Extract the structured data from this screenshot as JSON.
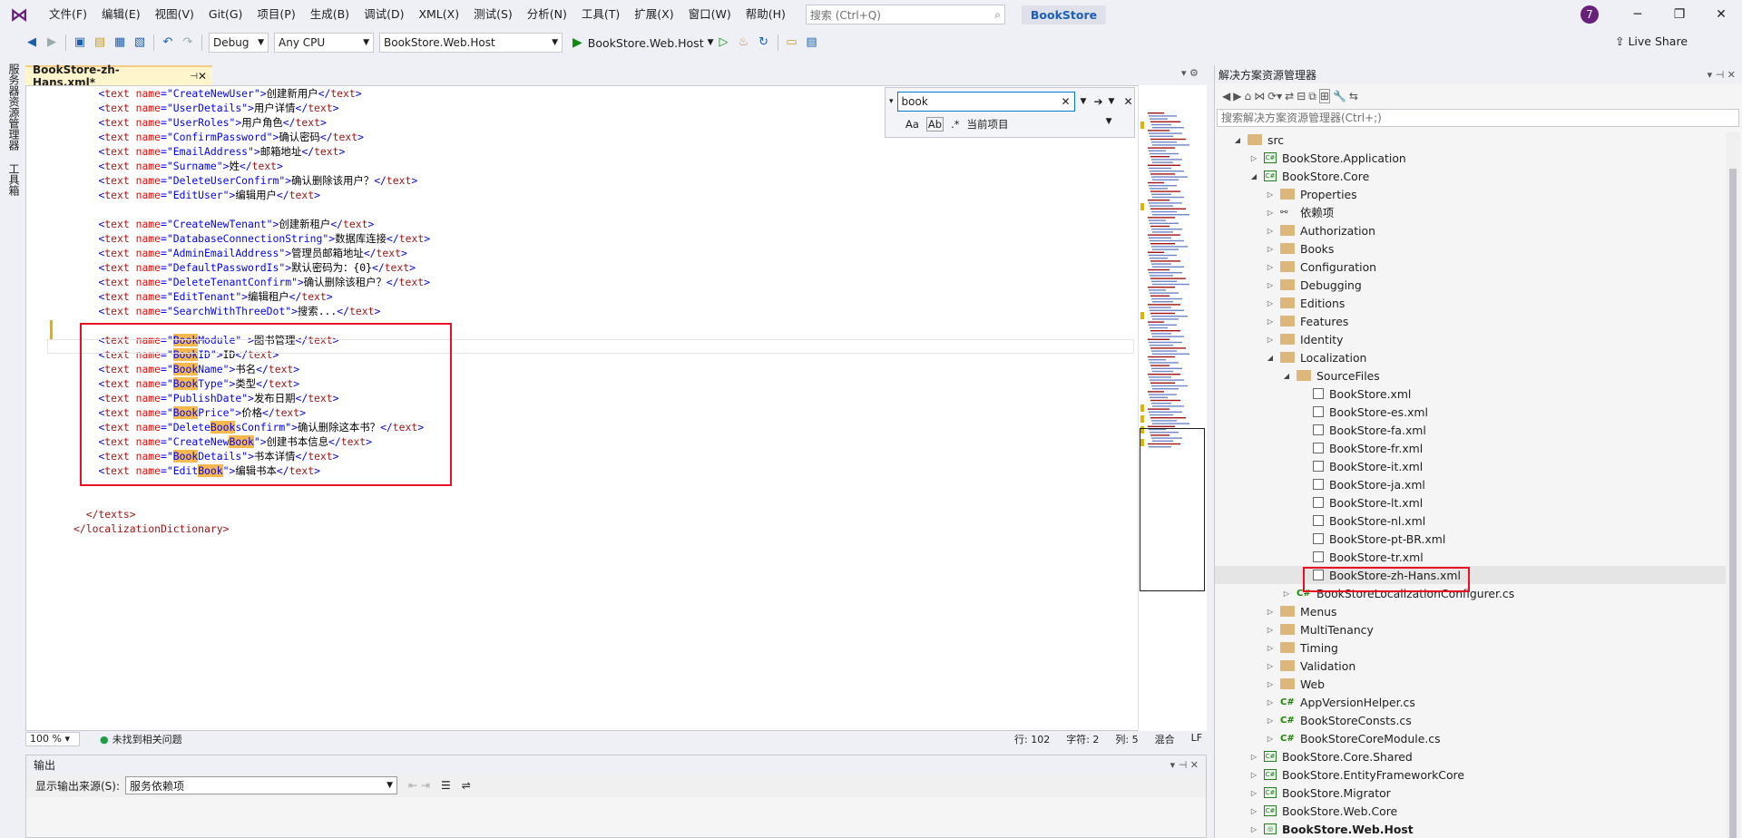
{
  "menu": [
    "文件(F)",
    "编辑(E)",
    "视图(V)",
    "Git(G)",
    "项目(P)",
    "生成(B)",
    "调试(D)",
    "XML(X)",
    "测试(S)",
    "分析(N)",
    "工具(T)",
    "扩展(X)",
    "窗口(W)",
    "帮助(H)"
  ],
  "search": {
    "placeholder": "搜索 (Ctrl+Q)"
  },
  "app_name": "BookStore",
  "avatar_text": "7",
  "toolbar": {
    "config": "Debug",
    "platform": "Any CPU",
    "startup": "BookStore.Web.Host",
    "run_label": "BookStore.Web.Host",
    "live_share": "Live Share"
  },
  "side_tabs": [
    "服务器资源管理器",
    "工具箱"
  ],
  "doc_tab": {
    "title": "BookStore-zh-Hans.xml*"
  },
  "code_lines": [
    {
      "k": "CreateNewUser",
      "v": "创建新用户"
    },
    {
      "k": "UserDetails",
      "v": "用户详情"
    },
    {
      "k": "UserRoles",
      "v": "用户角色"
    },
    {
      "k": "ConfirmPassword",
      "v": "确认密码"
    },
    {
      "k": "EmailAddress",
      "v": "邮箱地址"
    },
    {
      "k": "Surname",
      "v": "姓"
    },
    {
      "k": "DeleteUserConfirm",
      "v": "确认删除该用户？"
    },
    {
      "k": "EditUser",
      "v": "编辑用户"
    },
    {
      "blank": true
    },
    {
      "k": "CreateNewTenant",
      "v": "创建新租户"
    },
    {
      "k": "DatabaseConnectionString",
      "v": "数据库连接"
    },
    {
      "k": "AdminEmailAddress",
      "v": "管理员邮箱地址"
    },
    {
      "k": "DefaultPasswordIs",
      "v": "默认密码为：{0}"
    },
    {
      "k": "DeleteTenantConfirm",
      "v": "确认删除该租户？"
    },
    {
      "k": "EditTenant",
      "v": "编辑租户"
    },
    {
      "k": "SearchWithThreeDot",
      "v": "搜索..."
    },
    {
      "blank": true
    },
    {
      "k": "BookModule",
      "v": "图书管理",
      "pre": "Book",
      "post": "Module",
      "space": true
    },
    {
      "k": "BookID",
      "v": "ID",
      "pre": "Book",
      "post": "ID"
    },
    {
      "k": "BookName",
      "v": "书名",
      "pre": "Book",
      "post": "Name"
    },
    {
      "k": "BookType",
      "v": "类型",
      "pre": "Book",
      "post": "Type"
    },
    {
      "k": "PublishDate",
      "v": "发布日期"
    },
    {
      "k": "BookPrice",
      "v": "价格",
      "pre": "Book",
      "post": "Price"
    },
    {
      "k": "DeleteBooksConfirm",
      "v": "确认删除这本书？",
      "mid": [
        "Delete",
        "Book",
        "sConfirm"
      ]
    },
    {
      "k": "CreateNewBook",
      "v": "创建书本信息",
      "mid": [
        "CreateNew",
        "Book",
        ""
      ]
    },
    {
      "k": "BookDetails",
      "v": "书本详情",
      "pre": "Book",
      "post": "Details"
    },
    {
      "k": "EditBook",
      "v": "编辑书本",
      "mid": [
        "Edit",
        "Book",
        ""
      ]
    },
    {
      "blank": true
    },
    {
      "blank": true
    },
    {
      "close": "  </texts>"
    },
    {
      "close": "</localizationDictionary>"
    }
  ],
  "find": {
    "query": "book",
    "scope": "当前项目",
    "opt_case": "Aa",
    "opt_word": "Ab",
    "opt_regex": ".*"
  },
  "status": {
    "zoom": "100 %",
    "issues": "未找到相关问题",
    "line": "行: 102",
    "char": "字符: 2",
    "col": "列: 5",
    "mixed": "混合",
    "eol": "LF"
  },
  "output": {
    "title": "输出",
    "source_label": "显示输出来源(S):",
    "source_value": "服务依赖项"
  },
  "solution_explorer": {
    "title": "解决方案资源管理器",
    "search_placeholder": "搜索解决方案资源管理器(Ctrl+;)",
    "items": [
      {
        "label": "src",
        "level": 0,
        "icon": "folder",
        "exp": "open"
      },
      {
        "label": "BookStore.Application",
        "level": 1,
        "icon": "proj",
        "exp": "closed"
      },
      {
        "label": "BookStore.Core",
        "level": 1,
        "icon": "proj",
        "exp": "open"
      },
      {
        "label": "Properties",
        "level": 2,
        "icon": "props",
        "exp": "closed"
      },
      {
        "label": "依赖项",
        "level": 2,
        "icon": "deps",
        "exp": "closed"
      },
      {
        "label": "Authorization",
        "level": 2,
        "icon": "folder",
        "exp": "closed"
      },
      {
        "label": "Books",
        "level": 2,
        "icon": "folder",
        "exp": "closed"
      },
      {
        "label": "Configuration",
        "level": 2,
        "icon": "folder",
        "exp": "closed"
      },
      {
        "label": "Debugging",
        "level": 2,
        "icon": "folder",
        "exp": "closed"
      },
      {
        "label": "Editions",
        "level": 2,
        "icon": "folder",
        "exp": "closed"
      },
      {
        "label": "Features",
        "level": 2,
        "icon": "folder",
        "exp": "closed"
      },
      {
        "label": "Identity",
        "level": 2,
        "icon": "folder",
        "exp": "closed"
      },
      {
        "label": "Localization",
        "level": 2,
        "icon": "folder",
        "exp": "open"
      },
      {
        "label": "SourceFiles",
        "level": 3,
        "icon": "folder",
        "exp": "open"
      },
      {
        "label": "BookStore.xml",
        "level": 4,
        "icon": "xml",
        "exp": ""
      },
      {
        "label": "BookStore-es.xml",
        "level": 4,
        "icon": "xml",
        "exp": ""
      },
      {
        "label": "BookStore-fa.xml",
        "level": 4,
        "icon": "xml",
        "exp": ""
      },
      {
        "label": "BookStore-fr.xml",
        "level": 4,
        "icon": "xml",
        "exp": ""
      },
      {
        "label": "BookStore-it.xml",
        "level": 4,
        "icon": "xml",
        "exp": ""
      },
      {
        "label": "BookStore-ja.xml",
        "level": 4,
        "icon": "xml",
        "exp": ""
      },
      {
        "label": "BookStore-lt.xml",
        "level": 4,
        "icon": "xml",
        "exp": ""
      },
      {
        "label": "BookStore-nl.xml",
        "level": 4,
        "icon": "xml",
        "exp": ""
      },
      {
        "label": "BookStore-pt-BR.xml",
        "level": 4,
        "icon": "xml",
        "exp": ""
      },
      {
        "label": "BookStore-tr.xml",
        "level": 4,
        "icon": "xml",
        "exp": ""
      },
      {
        "label": "BookStore-zh-Hans.xml",
        "level": 4,
        "icon": "xml",
        "exp": "",
        "selected": true
      },
      {
        "label": "BookStoreLocalizationConfigurer.cs",
        "level": 3,
        "icon": "cs",
        "exp": "closed"
      },
      {
        "label": "Menus",
        "level": 2,
        "icon": "folder",
        "exp": "closed"
      },
      {
        "label": "MultiTenancy",
        "level": 2,
        "icon": "folder",
        "exp": "closed"
      },
      {
        "label": "Timing",
        "level": 2,
        "icon": "folder",
        "exp": "closed"
      },
      {
        "label": "Validation",
        "level": 2,
        "icon": "folder",
        "exp": "closed"
      },
      {
        "label": "Web",
        "level": 2,
        "icon": "folder",
        "exp": "closed"
      },
      {
        "label": "AppVersionHelper.cs",
        "level": 2,
        "icon": "cs",
        "exp": "closed"
      },
      {
        "label": "BookStoreConsts.cs",
        "level": 2,
        "icon": "cs",
        "exp": "closed"
      },
      {
        "label": "BookStoreCoreModule.cs",
        "level": 2,
        "icon": "cs",
        "exp": "closed"
      },
      {
        "label": "BookStore.Core.Shared",
        "level": 1,
        "icon": "proj",
        "exp": "closed"
      },
      {
        "label": "BookStore.EntityFrameworkCore",
        "level": 1,
        "icon": "proj",
        "exp": "closed"
      },
      {
        "label": "BookStore.Migrator",
        "level": 1,
        "icon": "proj",
        "exp": "closed"
      },
      {
        "label": "BookStore.Web.Core",
        "level": 1,
        "icon": "proj",
        "exp": "closed"
      },
      {
        "label": "BookStore.Web.Host",
        "level": 1,
        "icon": "web",
        "exp": "closed",
        "bold": true
      }
    ]
  }
}
